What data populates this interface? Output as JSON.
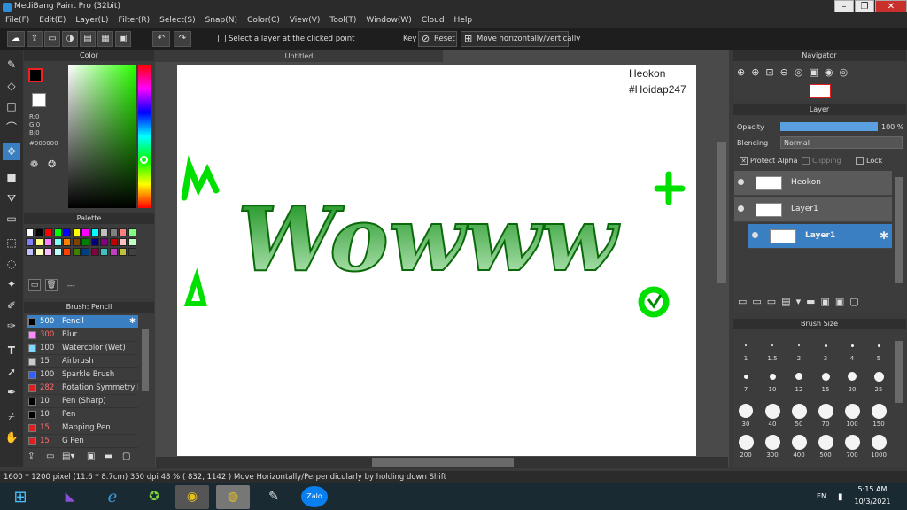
{
  "window": {
    "title": "MediBang Paint Pro (32bit)"
  },
  "menu": [
    "File(F)",
    "Edit(E)",
    "Layer(L)",
    "Filter(R)",
    "Select(S)",
    "Snap(N)",
    "Color(C)",
    "View(V)",
    "Tool(T)",
    "Window(W)",
    "Cloud",
    "Help"
  ],
  "toolbar": {
    "select_layer_label": "Select a layer at the clicked point",
    "key_label": "Key",
    "reset_label": "Reset",
    "move_hv_label": "Move horizontally/vertically"
  },
  "color_panel": {
    "title": "Color",
    "r": "R:0",
    "g": "G:0",
    "b": "B:0",
    "hex": "#000000",
    "fg": "#000000",
    "bg": "#ffffff"
  },
  "palette_panel": {
    "title": "Palette",
    "dashes": "---",
    "swatches": [
      "#ffffff",
      "#000000",
      "#ff0000",
      "#00ff00",
      "#0000ff",
      "#ffff00",
      "#ff00ff",
      "#00ffff",
      "#c0c0c0",
      "#808080",
      "#ff8080",
      "#80ff80",
      "#8080ff",
      "#ffff80",
      "#ff80ff",
      "#80ffff",
      "#ff8000",
      "#804000",
      "#008000",
      "#000080",
      "#800080",
      "#c00000",
      "#ffc0c0",
      "#c0ffc0",
      "#c0c0ff",
      "#ffffc0",
      "#ffc0ff",
      "#c0ffff",
      "#ff4000",
      "#408000",
      "#004080",
      "#800040",
      "#40c0c0",
      "#c040c0",
      "#c0c040",
      "#404040"
    ]
  },
  "brush_panel": {
    "title": "Brush: Pencil",
    "brushes": [
      {
        "size": "500",
        "name": "Pencil",
        "color": "#000000"
      },
      {
        "size": "300",
        "name": "Blur",
        "color": "#ff88ff"
      },
      {
        "size": "100",
        "name": "Watercolor (Wet)",
        "color": "#7fd8ff"
      },
      {
        "size": "15",
        "name": "Airbrush",
        "color": "#cccccc"
      },
      {
        "size": "100",
        "name": "Sparkle Brush",
        "color": "#3060ff"
      },
      {
        "size": "282",
        "name": "Rotation Symmetry P",
        "color": "#e02020"
      },
      {
        "size": "10",
        "name": "Pen (Sharp)",
        "color": "#000000"
      },
      {
        "size": "10",
        "name": "Pen",
        "color": "#000000"
      },
      {
        "size": "15",
        "name": "Mapping Pen",
        "color": "#e02020"
      },
      {
        "size": "15",
        "name": "G Pen",
        "color": "#e02020"
      }
    ]
  },
  "document": {
    "tab": "Untitled",
    "text_line1": "Heokon",
    "text_line2": "#Hoidap247",
    "art_text": "Wowww"
  },
  "navigator": {
    "title": "Navigator"
  },
  "layer_panel": {
    "title": "Layer",
    "opacity_label": "Opacity",
    "opacity_value": "100 %",
    "opacity": 1.0,
    "blending_label": "Blending",
    "blending_value": "Normal",
    "protect_alpha": "Protect Alpha",
    "clipping": "Clipping",
    "lock": "Lock",
    "layers": [
      {
        "name": "Heokon"
      },
      {
        "name": "Layer1"
      },
      {
        "name": "Layer1"
      }
    ]
  },
  "brush_size_panel": {
    "title": "Brush Size",
    "sizes": [
      "1",
      "1.5",
      "2",
      "3",
      "4",
      "5",
      "7",
      "10",
      "12",
      "15",
      "20",
      "25",
      "30",
      "40",
      "50",
      "70",
      "100",
      "150",
      "200",
      "300",
      "400",
      "500",
      "700",
      "1000"
    ]
  },
  "status": {
    "dims": "1600 * 1200 pixel",
    "cm": "(11.6 * 8.7cm)",
    "dpi": "350 dpi",
    "zoom": "48 %",
    "coords": "( 832, 1142 )",
    "hint": "Move Horizontally/Perpendicularly by holding down Shift"
  },
  "taskbar": {
    "lang": "EN",
    "time": "5:15 AM",
    "date": "10/3/2021",
    "zalo": "Zalo"
  }
}
